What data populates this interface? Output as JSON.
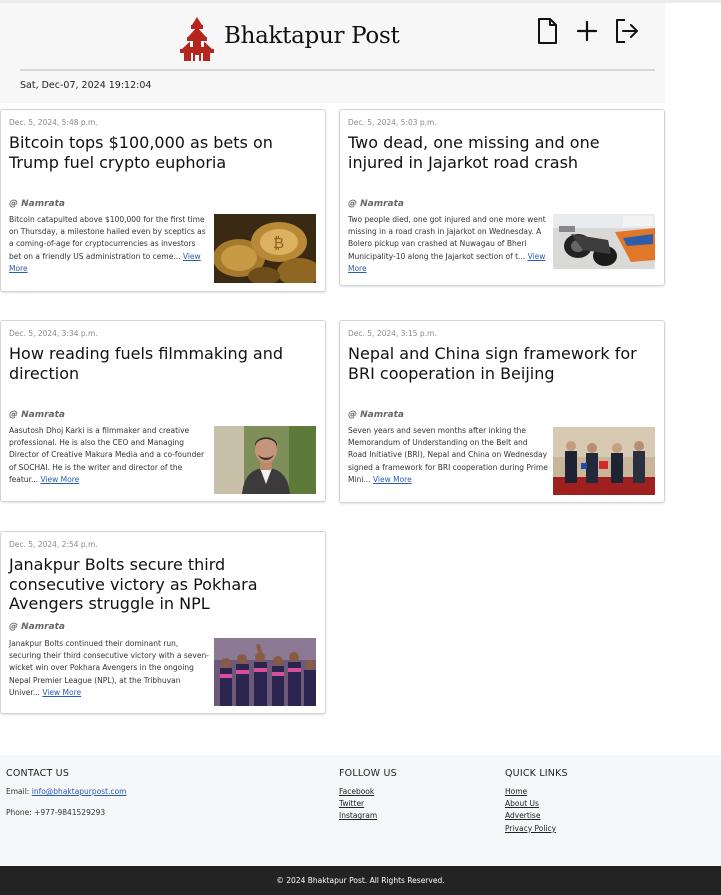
{
  "header": {
    "site_name": "Bhaktapur Post",
    "datetime": "Sat, Dec-07, 2024 19:12:04",
    "actions": [
      {
        "name": "new-document",
        "icon": "file-icon"
      },
      {
        "name": "add",
        "icon": "plus-icon"
      },
      {
        "name": "logout",
        "icon": "logout-icon"
      }
    ]
  },
  "articles": [
    {
      "date": "Dec. 5, 2024, 5:48 p.m.",
      "title": "Bitcoin tops $100,000 as bets on Trump fuel crypto euphoria",
      "author": "@ Namrata",
      "excerpt": "Bitcoin catapulted above $100,000 for the first time on Thursday, a milestone hailed even by sceptics as a coming-of-age for cryptocurrencies as investors bet on a friendly US administration to ceme...",
      "more": "View More",
      "image": "bitcoin-coins"
    },
    {
      "date": "Dec. 5, 2024, 5:03 p.m.",
      "title": "Two dead, one missing and one injured in Jajarkot road crash",
      "author": "@ Namrata",
      "excerpt": "Two people died, one got injured and one more went missing in a road crash in Jajarkot on Wednesday. A Bolero pickup van crashed at Nuwagau of Bheri Municipality-10 along the Jajarkot section of t...",
      "more": "View More",
      "image": "crashed-motorbike"
    },
    {
      "date": "Dec. 5, 2024, 3:34 p.m.",
      "title": "How reading fuels filmmaking and direction",
      "author": "@ Namrata",
      "excerpt": "Aasutosh Dhoj Karki is a filmmaker and creative professional. He is also the CEO and Managing Director of Creative Makura Media and a co-founder of SOCHAI. He is the writer and director of the featur...",
      "more": "View More",
      "image": "man-portrait"
    },
    {
      "date": "Dec. 5, 2024, 3:15 p.m.",
      "title": "Nepal and China sign framework for BRI cooperation in Beijing",
      "author": "@ Namrata",
      "excerpt": "Seven years and seven months after inking the Memorandum of Understanding on the Belt and Road Initiative (BRI), Nepal and China on Wednesday signed a framework for BRI cooperation during Prime Mini...",
      "more": "View More",
      "image": "signing-ceremony"
    },
    {
      "date": "Dec. 5, 2024, 2:54 p.m.",
      "title": "Janakpur Bolts secure third consecutive victory as Pokhara Avengers struggle in NPL",
      "author": "@ Namrata",
      "excerpt": "Janakpur Bolts continued their dominant run, securing their third consecutive victory with a seven-wicket win over Pokhara Avengers in the ongoing Nepal Premier League (NPL), at the Tribhuvan Univer...",
      "more": "View More",
      "image": "cricket-team"
    }
  ],
  "footer": {
    "contact": {
      "heading": "CONTACT US",
      "email_label": "Email:",
      "email": "info@bhaktapurpost.com",
      "phone": "Phone: +977-9841529293"
    },
    "follow": {
      "heading": "FOLLOW US",
      "links": [
        "Facebook",
        "Twitter",
        "Instagram"
      ]
    },
    "quick": {
      "heading": "QUICK LINKS",
      "links": [
        "Home",
        "About Us",
        "Advertise",
        "Privacy Policy"
      ]
    },
    "copyright": "© 2024 Bhaktapur Post. All Rights Reserved."
  },
  "colors": {
    "logo": "#b5261e",
    "link": "#2a5db0",
    "footer_bar": "#232323"
  }
}
